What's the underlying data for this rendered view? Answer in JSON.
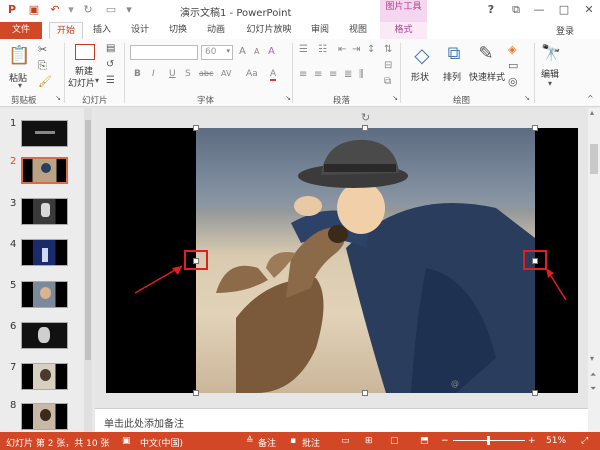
{
  "titlebar": {
    "title": "演示文稿1 - PowerPoint",
    "picture_tools": "图片工具",
    "help": "?",
    "minimize": "—",
    "maximize": "□",
    "close": "✕"
  },
  "tabs": {
    "file": "文件",
    "home": "开始",
    "insert": "插入",
    "design": "设计",
    "transitions": "切换",
    "animations": "动画",
    "slideshow": "幻灯片放映",
    "review": "审阅",
    "view": "视图",
    "format": "格式",
    "login": "登录"
  },
  "ribbon": {
    "clipboard": {
      "paste": "粘贴",
      "label": "剪贴板"
    },
    "slides": {
      "new_slide": "新建",
      "new_slide_2": "幻灯片",
      "label": "幻灯片"
    },
    "font": {
      "size_value": "60",
      "bold": "B",
      "italic": "I",
      "underline": "U",
      "strike": "S",
      "shadow": "abc",
      "spacing": "AV",
      "case": "Aa",
      "color": "A",
      "grow": "A",
      "shrink": "A",
      "clear": "A",
      "label": "字体"
    },
    "paragraph": {
      "label": "段落"
    },
    "drawing": {
      "shapes": "形状",
      "arrange": "排列",
      "quick_styles": "快速样式",
      "label": "绘图"
    },
    "editing": {
      "edit": "编辑"
    }
  },
  "slides_panel": {
    "numbers": [
      "1",
      "2",
      "3",
      "4",
      "5",
      "6",
      "7",
      "8"
    ],
    "active_index": 2
  },
  "notes": {
    "placeholder": "单击此处添加备注"
  },
  "statusbar": {
    "slide_info": "幻灯片 第 2 张，共 10 张",
    "language": "中文(中国)",
    "notes": "备注",
    "comments": "批注",
    "zoom": "51%",
    "minus": "−",
    "plus": "+"
  },
  "colors": {
    "accent": "#d24726",
    "format_tab": "#b0418f",
    "selection_box": "#e02020"
  }
}
